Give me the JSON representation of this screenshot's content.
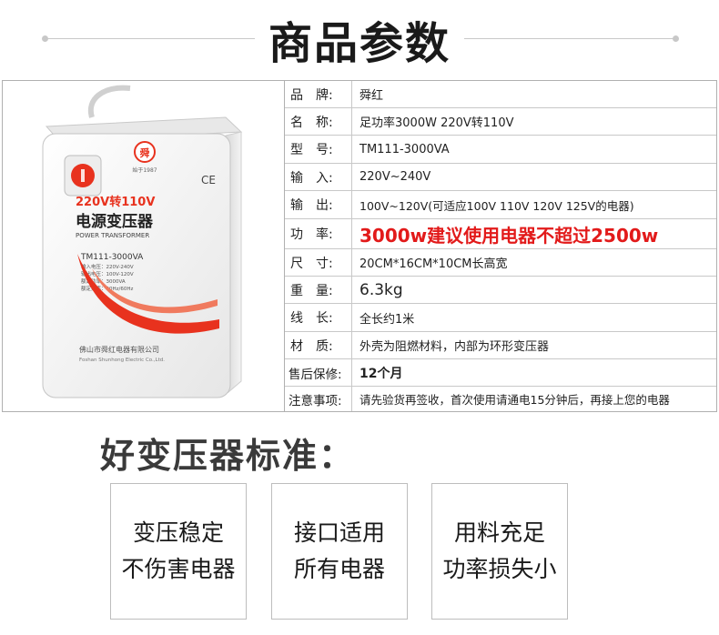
{
  "header": {
    "title": "商品参数"
  },
  "product_image": {
    "brand_box": "220V转110V",
    "name": "电源变压器",
    "name_en": "POWER TRANSFORMER",
    "model": "TM111-3000VA",
    "specs": [
      "输入电压：220V-240V",
      "输出电压：100V-120V",
      "额定功率：3000VA",
      "额定频率：50Hz/60Hz"
    ],
    "maker": "佛山市舜红电器有限公司",
    "maker_en": "Foshan Shunhong Electric Co.,Ltd.",
    "logo_char": "舜",
    "logo_caption": "始于1987",
    "ce": "CE",
    "accent_color": "#e8321e"
  },
  "specs": [
    {
      "key": "品　牌:",
      "value": "舜红"
    },
    {
      "key": "名　称:",
      "value": "足功率3000W  220V转110V"
    },
    {
      "key": "型　号:",
      "value": "TM111-3000VA"
    },
    {
      "key": "输　入:",
      "value": "220V~240V"
    },
    {
      "key": "输　出:",
      "value": "100V~120V(可适应100V 110V 120V 125V的电器)"
    },
    {
      "key": "功　率:",
      "value": "3000w建议使用电器不超过2500w"
    },
    {
      "key": "尺　寸:",
      "value": "20CM*16CM*10CM长高宽"
    },
    {
      "key": "重　量:",
      "value": "6.3kg"
    },
    {
      "key": "线　长:",
      "value": "全长约1米"
    },
    {
      "key": "材　质:",
      "value": "外壳为阻燃材料，内部为环形变压器"
    },
    {
      "key": "售后保修:",
      "value": "12个月"
    },
    {
      "key": "注意事项:",
      "value": "请先验货再签收，首次使用请通电15分钟后，再接上您的电器"
    }
  ],
  "section": {
    "title": "好变压器标准："
  },
  "features": [
    {
      "line1": "变压稳定",
      "line2": "不伤害电器"
    },
    {
      "line1": "接口适用",
      "line2": "所有电器"
    },
    {
      "line1": "用料充足",
      "line2": "功率损失小"
    }
  ],
  "colors": {
    "highlight_red": "#e21a1a",
    "border": "#b0b0b0"
  }
}
